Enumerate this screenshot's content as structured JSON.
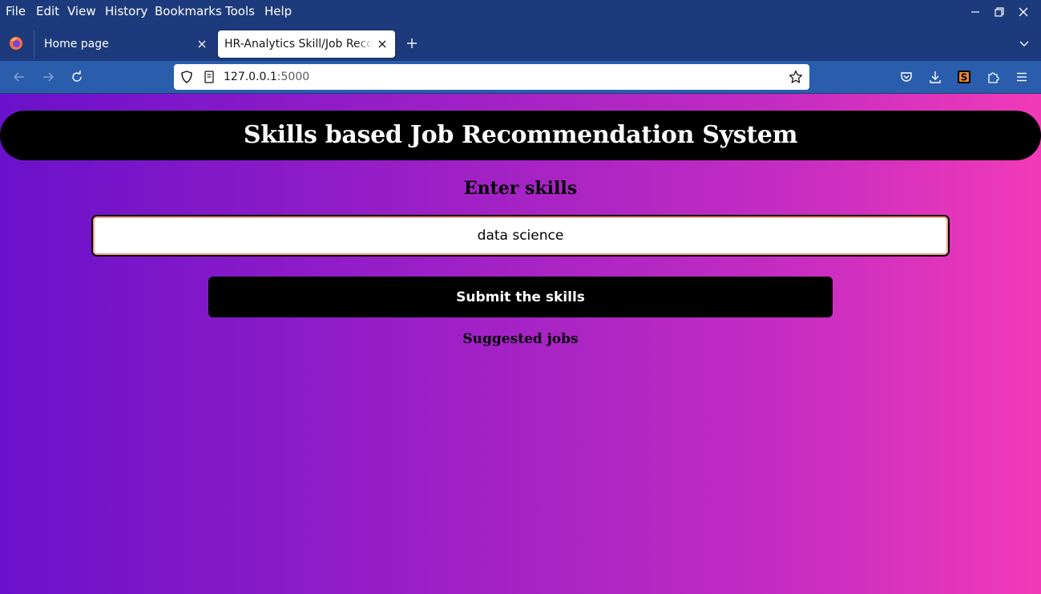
{
  "menubar": {
    "items": [
      "File",
      "Edit",
      "View",
      "History",
      "Bookmarks",
      "Tools",
      "Help"
    ]
  },
  "tabs": [
    {
      "label": "Home page",
      "active": false
    },
    {
      "label": "HR-Analytics Skill/Job Recom",
      "active": true
    }
  ],
  "navbar": {
    "url_host": "127.0.0.1",
    "url_port": ":5000"
  },
  "page": {
    "title": "Skills based Job Recommendation System",
    "skills_label": "Enter skills",
    "skills_value": "data science",
    "submit_label": "Submit the skills",
    "suggested_label": "Suggested jobs"
  },
  "colors": {
    "chrome_dark": "#1d3b7c",
    "navbar": "#2a5dac",
    "gradient_start": "#6a11cb",
    "gradient_end": "#f23ab8"
  }
}
